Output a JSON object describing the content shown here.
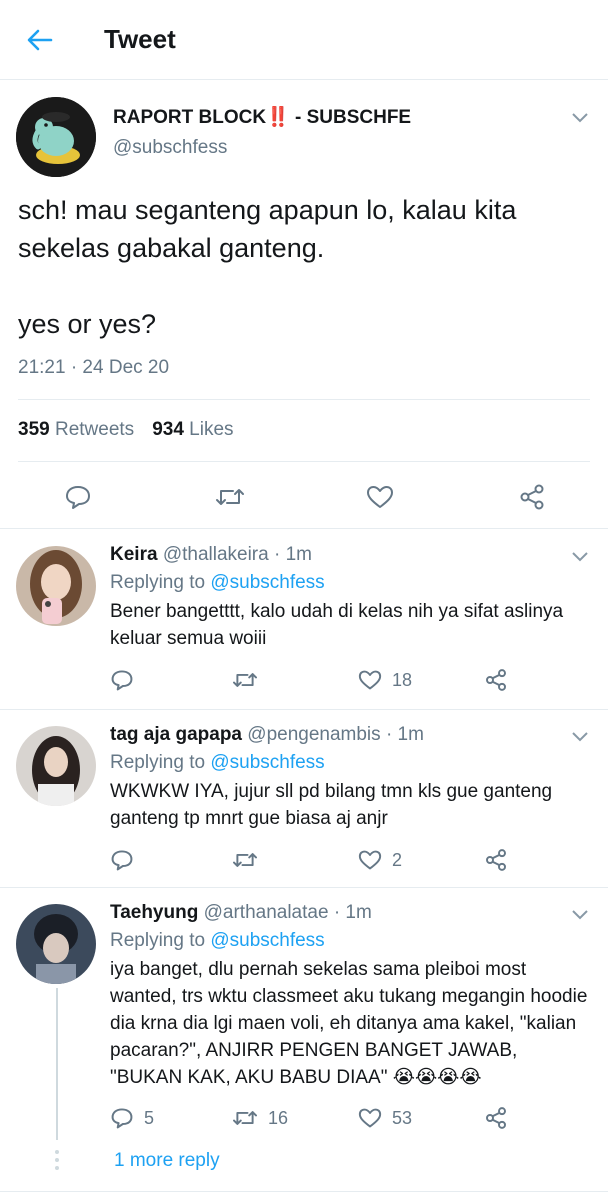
{
  "header": {
    "title": "Tweet",
    "back_icon": "arrow-left-icon"
  },
  "colors": {
    "accent": "#1da1f2",
    "text": "#14171a",
    "muted": "#657786",
    "border": "#e6ecf0"
  },
  "main_tweet": {
    "display_name": "RAPORT BLOCK‼️ - SUBSCHFE",
    "handle": "@subschfess",
    "text": "sch! mau seganteng apapun lo, kalau kita sekelas gabakal ganteng.\n\nyes or yes?",
    "timestamp": "21:21 · 24 Dec 20",
    "retweets_count": "359",
    "retweets_label": "Retweets",
    "likes_count": "934",
    "likes_label": "Likes",
    "actions": [
      "reply-icon",
      "retweet-icon",
      "like-icon",
      "share-icon"
    ]
  },
  "replies": [
    {
      "display_name": "Keira",
      "handle": "@thallakeira",
      "time": "· 1m",
      "replying_prefix": "Replying to",
      "replying_to": "@subschfess",
      "text": "Bener bangetttt, kalo udah di kelas nih ya sifat aslinya keluar semua woiii",
      "reply_count": "",
      "retweet_count": "",
      "like_count": "18"
    },
    {
      "display_name": "tag aja gapapa",
      "handle": "@pengenambis",
      "time": "· 1m",
      "replying_prefix": "Replying to",
      "replying_to": "@subschfess",
      "text": "WKWKW IYA, jujur sll pd bilang tmn kls gue ganteng ganteng tp mnrt gue biasa aj anjr",
      "reply_count": "",
      "retweet_count": "",
      "like_count": "2"
    },
    {
      "display_name": "Taehyung",
      "handle": "@arthanalatae",
      "time": "· 1m",
      "replying_prefix": "Replying to",
      "replying_to": "@subschfess",
      "text": "iya banget, dlu pernah sekelas sama pleiboi most wanted, trs wktu classmeet aku tukang megangin hoodie dia krna dia lgi maen voli, eh ditanya ama kakel, \"kalian pacaran?\", ANJIRR PENGEN BANGET JAWAB, \"BUKAN KAK, AKU BABU DIAA\" 😭😭😭😭",
      "reply_count": "5",
      "retweet_count": "16",
      "like_count": "53",
      "more_replies": "1 more reply"
    }
  ]
}
